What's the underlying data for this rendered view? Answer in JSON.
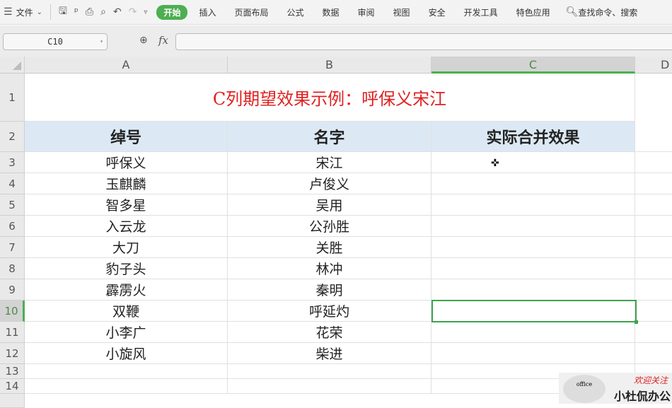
{
  "toolbar": {
    "menu": "文件",
    "start": "开始",
    "tabs": [
      "插入",
      "页面布局",
      "公式",
      "数据",
      "审阅",
      "视图",
      "安全",
      "开发工具",
      "特色应用"
    ],
    "search": "查找命令、搜索"
  },
  "formula_bar": {
    "name_box": "C10",
    "fx": "fx",
    "value": ""
  },
  "columns": [
    "A",
    "B",
    "C",
    "D"
  ],
  "selected_column": "C",
  "rows": [
    "1",
    "2",
    "3",
    "4",
    "5",
    "6",
    "7",
    "8",
    "9",
    "10",
    "11",
    "12",
    "13",
    "14"
  ],
  "selected_row": "10",
  "sheet": {
    "title": "C列期望效果示例：呼保义宋江",
    "headers": [
      "绰号",
      "名字",
      "实际合并效果"
    ],
    "data": [
      [
        "呼保义",
        "宋江"
      ],
      [
        "玉麒麟",
        "卢俊义"
      ],
      [
        "智多星",
        "吴用"
      ],
      [
        "入云龙",
        "公孙胜"
      ],
      [
        "大刀",
        "关胜"
      ],
      [
        "豹子头",
        "林冲"
      ],
      [
        "霹雳火",
        "秦明"
      ],
      [
        "双鞭",
        "呼延灼"
      ],
      [
        "小李广",
        "花荣"
      ],
      [
        "小旋风",
        "柴进"
      ]
    ]
  },
  "watermark": {
    "welcome": "欢迎关注",
    "name": "小杜侃办公",
    "logo_text": "office"
  }
}
